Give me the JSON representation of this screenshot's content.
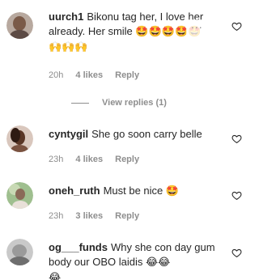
{
  "comments": [
    {
      "username": "uurch1",
      "text": "Bikonu tag her, I love her already. Her smile",
      "emojis": "🤩🤩🤩🤩🤩\n🙌🙌🙌",
      "time": "20h",
      "likes": "4 likes",
      "reply": "Reply"
    },
    {
      "username": "cyntygil",
      "text": "She go soon carry belle",
      "emojis": "",
      "time": "23h",
      "likes": "4 likes",
      "reply": "Reply"
    },
    {
      "username": "oneh_ruth",
      "text": "Must be nice",
      "emojis": "🤩",
      "time": "23h",
      "likes": "3 likes",
      "reply": "Reply"
    },
    {
      "username": "og___funds",
      "text": "Why she con day gum body our OBO laidis",
      "emojis": "😂😂\n😂",
      "time": "",
      "likes": "",
      "reply": ""
    }
  ],
  "view_replies": "View replies (1)",
  "more_indicator": "...",
  "icons": {
    "like": "heart-outline-icon"
  },
  "colors": {
    "text": "#262626",
    "meta": "#8e8e8e"
  }
}
